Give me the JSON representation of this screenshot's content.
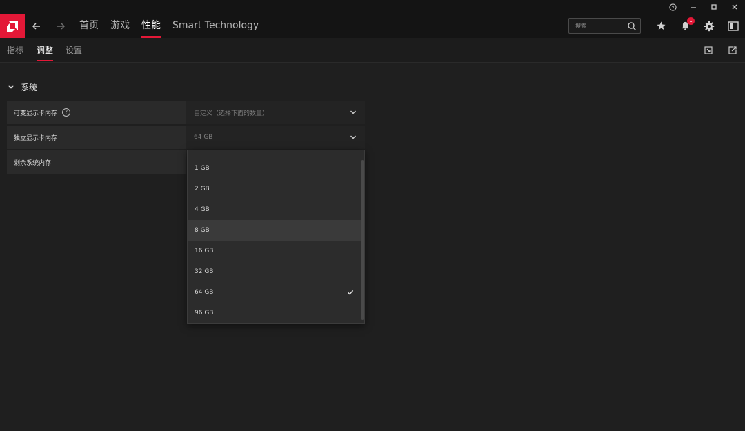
{
  "window_controls": {
    "help_icon": "help-circle-icon",
    "minimize_icon": "minimize-icon",
    "maximize_icon": "maximize-icon",
    "close_icon": "close-icon"
  },
  "topnav": {
    "logo_icon": "amd-logo-icon",
    "back_icon": "arrow-left-icon",
    "forward_icon": "arrow-right-icon",
    "tabs": [
      {
        "label": "首页",
        "active": false
      },
      {
        "label": "游戏",
        "active": false
      },
      {
        "label": "性能",
        "active": true
      },
      {
        "label": "Smart Technology",
        "active": false
      }
    ],
    "search_placeholder": "搜索",
    "notification_count": "1",
    "icons": [
      "star-icon",
      "bell-icon",
      "gear-icon",
      "sidebar-panel-icon"
    ]
  },
  "subnav": {
    "tabs": [
      {
        "label": "指标",
        "active": false
      },
      {
        "label": "调整",
        "active": true
      },
      {
        "label": "设置",
        "active": false
      }
    ],
    "icons": [
      "import-icon",
      "export-icon"
    ]
  },
  "section": {
    "title": "系统",
    "rows": [
      {
        "label": "可变显示卡内存",
        "value": "自定义（选择下面的数量）",
        "has_help": true
      },
      {
        "label": "独立显示卡内存",
        "value": "64 GB",
        "has_help": false
      },
      {
        "label": "剩余系统内存",
        "value": "",
        "has_help": false
      }
    ]
  },
  "dropdown": {
    "options": [
      "1 GB",
      "2 GB",
      "4 GB",
      "8 GB",
      "16 GB",
      "32 GB",
      "64 GB",
      "96 GB"
    ],
    "selected": "64 GB",
    "hovered": "8 GB"
  },
  "colors": {
    "accent": "#e31837",
    "background": "#1f1f1f",
    "bar": "#141414"
  }
}
